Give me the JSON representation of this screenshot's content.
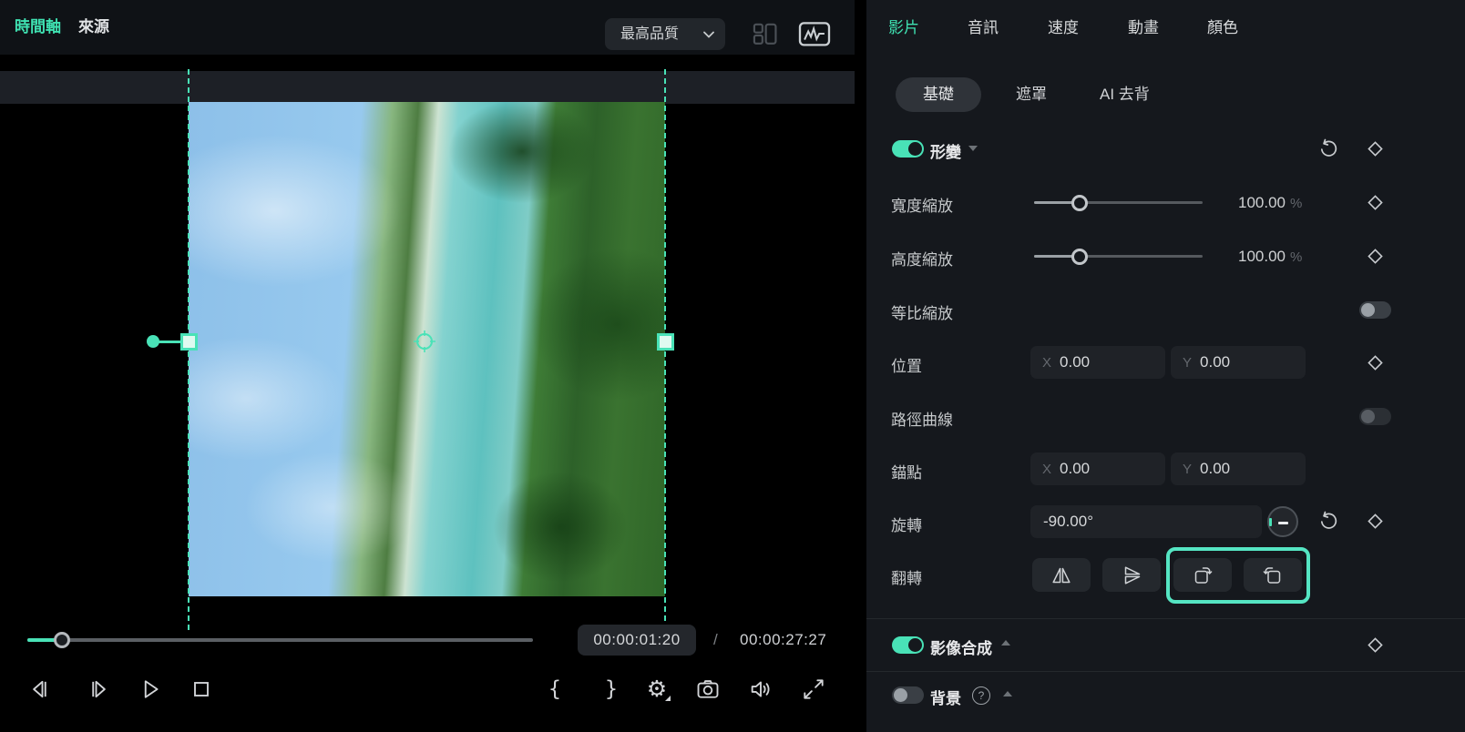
{
  "colors": {
    "accent": "#49e2b7",
    "panel_bg": "#15181d",
    "topbar_bg": "#0f1216",
    "highlight": "#55e5c3"
  },
  "topbar": {
    "tabs": [
      {
        "label": "時間軸",
        "active": true
      },
      {
        "label": "來源",
        "active": false
      }
    ],
    "quality_dropdown": {
      "value": "最高品質"
    },
    "icons": {
      "layout": "layout-grid-icon",
      "scopes": "scopes-waveform-icon"
    }
  },
  "player": {
    "current_time": "00:00:01:20",
    "separator": "/",
    "duration": "00:00:27:27",
    "icons": {
      "step_back": "step-back-icon",
      "step_forward": "step-forward-icon",
      "play": "play-icon",
      "stop": "stop-icon",
      "mark_in": "{",
      "mark_out": "}",
      "settings": "gear-icon",
      "snapshot": "camera-icon",
      "volume": "speaker-icon",
      "fullscreen": "expand-icon"
    },
    "settings_glyph": "⚙"
  },
  "panel": {
    "tabs": [
      {
        "label": "影片",
        "active": true
      },
      {
        "label": "音訊",
        "active": false
      },
      {
        "label": "速度",
        "active": false
      },
      {
        "label": "動畫",
        "active": false
      },
      {
        "label": "顏色",
        "active": false
      }
    ],
    "subtabs": [
      {
        "label": "基礎",
        "active": true
      },
      {
        "label": "遮罩",
        "active": false
      },
      {
        "label": "AI 去背",
        "active": false
      }
    ],
    "transform": {
      "title": "形變",
      "enabled": true,
      "width_scale": {
        "label": "寬度縮放",
        "value": "100.00",
        "unit": "%"
      },
      "height_scale": {
        "label": "高度縮放",
        "value": "100.00",
        "unit": "%"
      },
      "uniform_scale": {
        "label": "等比縮放",
        "enabled": false
      },
      "position": {
        "label": "位置",
        "x_prefix": "X",
        "x": "0.00",
        "y_prefix": "Y",
        "y": "0.00"
      },
      "path_curve": {
        "label": "路徑曲線",
        "enabled": false
      },
      "anchor": {
        "label": "錨點",
        "x_prefix": "X",
        "x": "0.00",
        "y_prefix": "Y",
        "y": "0.00"
      },
      "rotate": {
        "label": "旋轉",
        "value": "-90.00°"
      },
      "flip": {
        "label": "翻轉",
        "buttons": [
          "flip-horizontal-icon",
          "flip-vertical-icon",
          "rotate-cw-icon",
          "rotate-ccw-icon"
        ]
      }
    },
    "compositing": {
      "title": "影像合成",
      "enabled": true
    },
    "background": {
      "title": "背景",
      "enabled": false,
      "help": "?"
    }
  }
}
